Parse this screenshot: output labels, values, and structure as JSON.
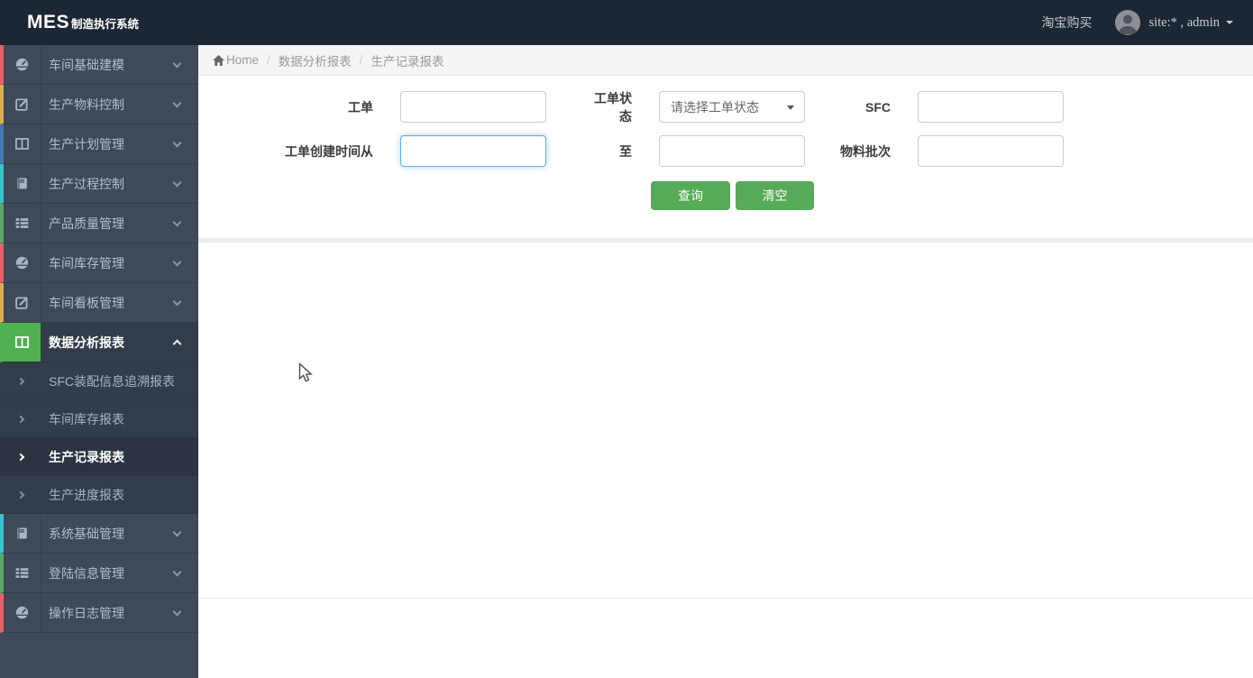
{
  "navbar": {
    "logo_main": "MES",
    "logo_sub": "制造执行系统",
    "taobao": "淘宝购买",
    "user": "site:* , admin"
  },
  "breadcrumb": {
    "home": "Home",
    "separator": "/",
    "level1": "数据分析报表",
    "level2": "生产记录报表"
  },
  "sidebar": {
    "items": [
      {
        "label": "车间基础建模",
        "icon": "dashboard-icon",
        "accent": "#e2636b",
        "active": false
      },
      {
        "label": "生产物料控制",
        "icon": "edit-icon",
        "accent": "#ddad54",
        "active": false
      },
      {
        "label": "生产计划管理",
        "icon": "columns-icon",
        "accent": "#4679b2",
        "active": false
      },
      {
        "label": "生产过程控制",
        "icon": "book-icon",
        "accent": "#3bc2cd",
        "active": false
      },
      {
        "label": "产品质量管理",
        "icon": "list-icon",
        "accent": "#61a75f",
        "active": false
      },
      {
        "label": "车间库存管理",
        "icon": "dashboard-icon",
        "accent": "#e2636b",
        "active": false
      },
      {
        "label": "车间看板管理",
        "icon": "edit-icon",
        "accent": "#ddad54",
        "active": false
      },
      {
        "label": "数据分析报表",
        "icon": "columns-icon",
        "accent": "#50b153",
        "active": true
      },
      {
        "label": "系统基础管理",
        "icon": "book-icon",
        "accent": "#3bc2cd",
        "active": false
      },
      {
        "label": "登陆信息管理",
        "icon": "list-icon",
        "accent": "#61a75f",
        "active": false
      },
      {
        "label": "操作日志管理",
        "icon": "dashboard-icon",
        "accent": "#e2636b",
        "active": false
      }
    ],
    "submenu": [
      {
        "label": "SFC装配信息追溯报表",
        "active": false
      },
      {
        "label": "车间库存报表",
        "active": false
      },
      {
        "label": "生产记录报表",
        "active": true
      },
      {
        "label": "生产进度报表",
        "active": false
      }
    ]
  },
  "form": {
    "fields": {
      "order_label": "工单",
      "order_value": "",
      "order_status_label": "工单状态",
      "order_status_value": "请选择工单状态",
      "sfc_label": "SFC",
      "sfc_value": "",
      "created_from_label": "工单创建时间从",
      "created_from_value": "",
      "to_label": "至",
      "to_value": "",
      "material_batch_label": "物料批次",
      "material_batch_value": ""
    },
    "buttons": {
      "query": "查询",
      "clear": "清空"
    }
  },
  "colors": {
    "navbar_bg": "#1c2733",
    "sidebar_bg": "#3e4a59",
    "submenu_bg": "#333d49",
    "active_green": "#50b153",
    "button_green": "#57aa57",
    "focus_blue": "#66afe9",
    "divider": "#e7ecf1"
  }
}
